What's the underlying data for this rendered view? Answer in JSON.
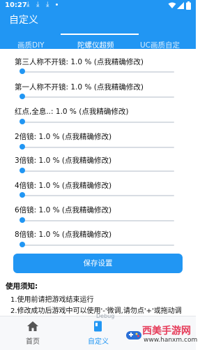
{
  "status_bar": {
    "time": "10:27",
    "download_icons": [
      "download-icon",
      "download-icon",
      "download-icon"
    ],
    "right_icons": [
      "wifi-icon",
      "signal-icon",
      "battery-icon"
    ]
  },
  "app_bar": {
    "title": "自定义",
    "tabs": [
      {
        "label": "画质DIY",
        "active": false
      },
      {
        "label": "陀螺仪超频",
        "active": true
      },
      {
        "label": "UC画质自定",
        "active": false
      }
    ]
  },
  "settings": [
    {
      "label": "第三人称不开镜:  1.0 % (点我精确修改)",
      "value_percent": 1.0
    },
    {
      "label": "第一人称不开镜:  1.0 % (点我精确修改)",
      "value_percent": 1.0
    },
    {
      "label": "红点,全息..:  1.0 % (点我精确修改)",
      "value_percent": 1.0
    },
    {
      "label": "2倍镜:  1.0 % (点我精确修改)",
      "value_percent": 1.0
    },
    {
      "label": "3倍镜:  1.0 % (点我精确修改)",
      "value_percent": 1.0
    },
    {
      "label": "4倍镜:  1.0 % (点我精确修改)",
      "value_percent": 1.0
    },
    {
      "label": "6倍镜:  1.0 % (点我精确修改)",
      "value_percent": 1.0
    },
    {
      "label": "8倍镜:  1.0 % (点我精确修改)",
      "value_percent": 1.0
    }
  ],
  "save_button": {
    "label": "保存设置"
  },
  "notes": {
    "title": "使用须知:",
    "lines": [
      "1.使用前请把游戏结束运行",
      "2.修改成功后游戏中可以使用'-'微调,请勿点'+'或拖动调"
    ]
  },
  "bottom_nav": {
    "items": [
      {
        "label": "首页",
        "icon": "home-icon",
        "active": false
      },
      {
        "label": "自定义",
        "icon": "book-icon",
        "active": true
      }
    ],
    "debug_label": "Debug"
  },
  "watermark": {
    "text": "西美手游网",
    "url": "www.hanxm.com"
  },
  "colors": {
    "primary": "#2196f3",
    "track": "#d8dde3",
    "watermark_red": "#e63c5a"
  }
}
